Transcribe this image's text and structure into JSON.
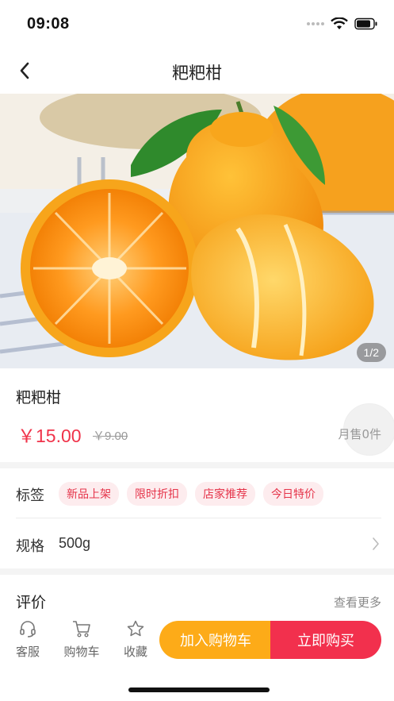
{
  "status_bar": {
    "time": "09:08"
  },
  "nav": {
    "title": "粑粑柑"
  },
  "hero": {
    "page_indicator": "1/2"
  },
  "product": {
    "name": "粑粑柑",
    "price": "￥15.00",
    "old_price": "￥9.00",
    "monthly_sales": "月售0件"
  },
  "tags": {
    "label": "标签",
    "items": [
      "新品上架",
      "限时折扣",
      "店家推荐",
      "今日特价"
    ]
  },
  "spec": {
    "label": "规格",
    "value": "500g"
  },
  "reviews": {
    "title": "评价",
    "more": "查看更多"
  },
  "bottom_bar": {
    "service_label": "客服",
    "cart_label": "购物车",
    "favorite_label": "收藏",
    "add_to_cart": "加入购物车",
    "buy_now": "立即购买"
  },
  "colors": {
    "price": "#f0334a",
    "tag_bg": "#fdecee",
    "tag_text": "#e5344a",
    "cart_button": "#fdab18",
    "buy_button": "#f2304d"
  },
  "icons": [
    "back-icon",
    "wifi-icon",
    "battery-icon",
    "headset-icon",
    "cart-icon",
    "star-icon",
    "chevron-right-icon"
  ]
}
